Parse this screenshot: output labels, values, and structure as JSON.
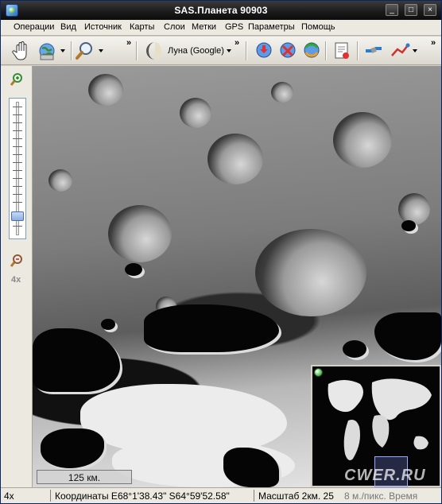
{
  "window": {
    "title": "SAS.Планета 90903"
  },
  "menu": [
    "Операции",
    "Вид",
    "Источник",
    "Карты",
    "Слои",
    "Метки",
    "GPS",
    "Параметры",
    "Помощь"
  ],
  "toolbar": {
    "map_source": "Луна (Google)",
    "overflow_glyph": "»"
  },
  "zoom": {
    "level_label": "4x",
    "slider_fraction": 0.82
  },
  "map": {
    "scale_label": "125 км."
  },
  "status": {
    "zoom": "4x",
    "coords": "Координаты E68°1'38.43\" S64°59'52.58\"",
    "scale": "Масштаб 2км. 25",
    "truncated_tail": "8 м./пикс. Время"
  },
  "watermark": "CWER.RU",
  "icons": {
    "hand": "hand-pan-icon",
    "globe": "globe-icon",
    "zoom": "magnifier-icon",
    "moon": "moon-icon"
  }
}
